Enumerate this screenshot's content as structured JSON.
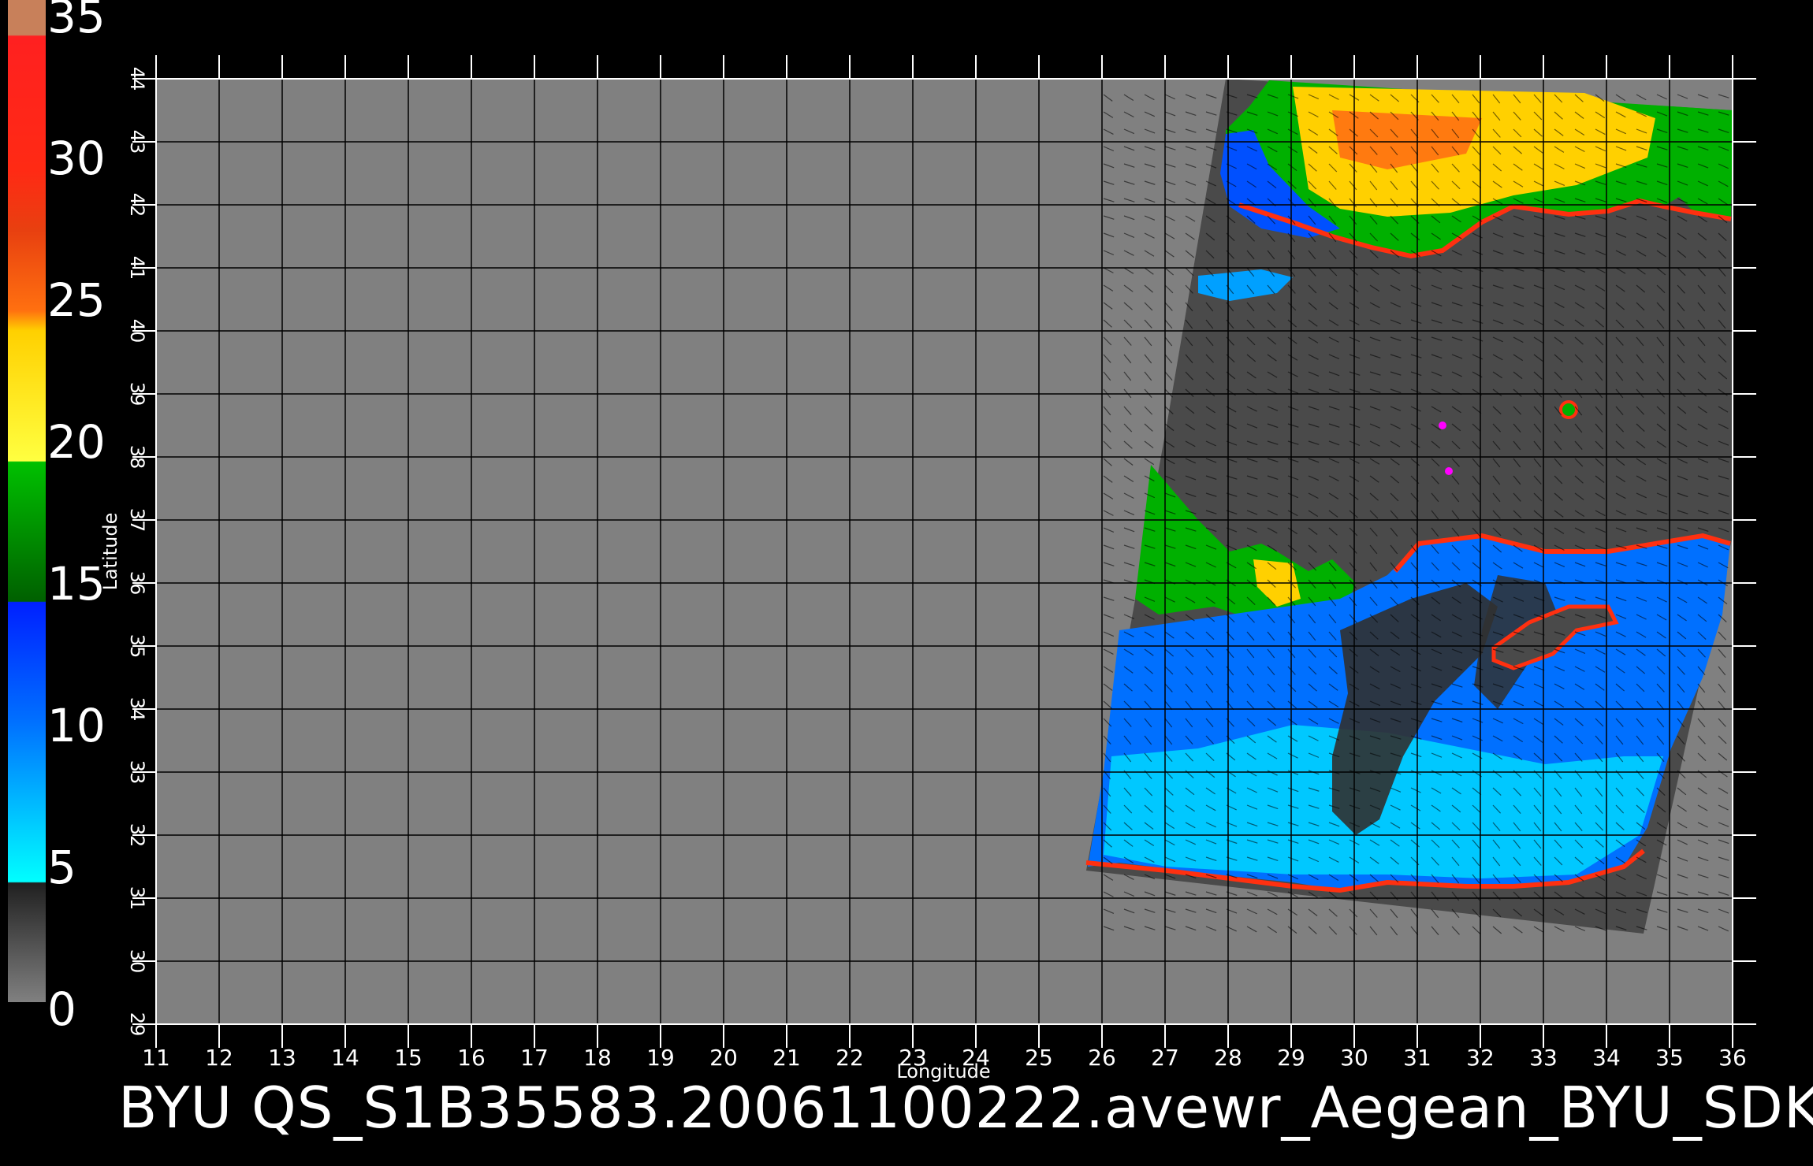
{
  "colorbar": {
    "labels": [
      "35",
      "30",
      "25",
      "20",
      "15",
      "10",
      "5",
      "0"
    ],
    "colors": [
      "#c8805a",
      "#ff2020",
      "#e83a10",
      "#ff7010",
      "#ffd000",
      "#ffff40",
      "#00c000",
      "#006000",
      "#0030ff",
      "#0090ff",
      "#00ffff",
      "#303030",
      "#808080"
    ]
  },
  "axes": {
    "xlabel": "Longitude",
    "ylabel": "Latitude",
    "x_ticks": [
      "11",
      "12",
      "13",
      "14",
      "15",
      "16",
      "17",
      "18",
      "19",
      "20",
      "21",
      "22",
      "23",
      "24",
      "25",
      "26",
      "27",
      "28",
      "29",
      "30",
      "31",
      "32",
      "33",
      "34",
      "35",
      "36"
    ],
    "y_ticks": [
      "29",
      "30",
      "31",
      "32",
      "33",
      "34",
      "35",
      "36",
      "37",
      "38",
      "39",
      "40",
      "41",
      "42",
      "43",
      "44"
    ]
  },
  "map": {
    "background_color": "#808080",
    "swath_color": "#4a4a4a",
    "grid_color": "#000000",
    "wind_speed_colors": {
      "low": "#00c8ff",
      "mid": "#0060ff",
      "calm": "#303030",
      "moderate": "#00b000",
      "strong": "#ffd000",
      "high": "#ff5010"
    }
  },
  "caption": "BYU  QS_S1B35583.20061100222.avewr_Aegean_BYU_SDK"
}
